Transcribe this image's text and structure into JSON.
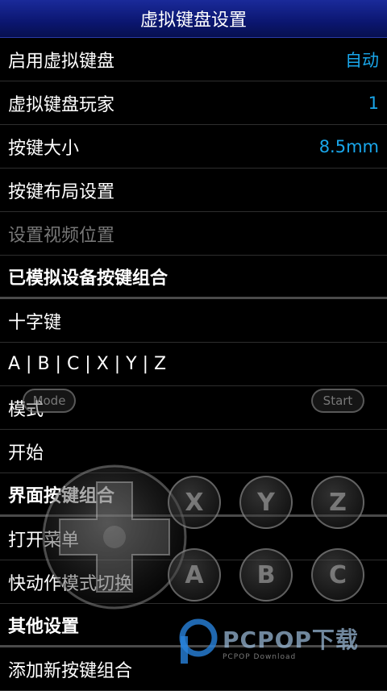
{
  "title": "虚拟键盘设置",
  "rows": [
    {
      "label": "启用虚拟键盘",
      "value": "自动"
    },
    {
      "label": "虚拟键盘玩家",
      "value": "1"
    },
    {
      "label": "按键大小",
      "value": "8.5mm"
    },
    {
      "label": "按键布局设置",
      "value": ""
    },
    {
      "label": "设置视频位置",
      "value": ""
    },
    {
      "label": "已模拟设备按键组合",
      "value": ""
    },
    {
      "label": "十字键",
      "value": ""
    },
    {
      "label": "A | B | C | X | Y | Z",
      "value": ""
    },
    {
      "label": "模式",
      "value": ""
    },
    {
      "label": "开始",
      "value": ""
    },
    {
      "label": "界面按键组合",
      "value": ""
    },
    {
      "label": "打开菜单",
      "value": ""
    },
    {
      "label": "快动作模式切换",
      "value": ""
    },
    {
      "label": "其他设置",
      "value": ""
    },
    {
      "label": "添加新按键组合",
      "value": ""
    }
  ],
  "overlay": {
    "mode_label": "Mode",
    "start_label": "Start",
    "buttons": [
      "X",
      "Y",
      "Z",
      "A",
      "B",
      "C"
    ]
  },
  "watermark": {
    "brand": "PCPOP下载",
    "sub": "PCPOP Download"
  },
  "colors": {
    "accent": "#19a6ea",
    "titlebar": "#0b1670",
    "disabled": "#777777"
  }
}
